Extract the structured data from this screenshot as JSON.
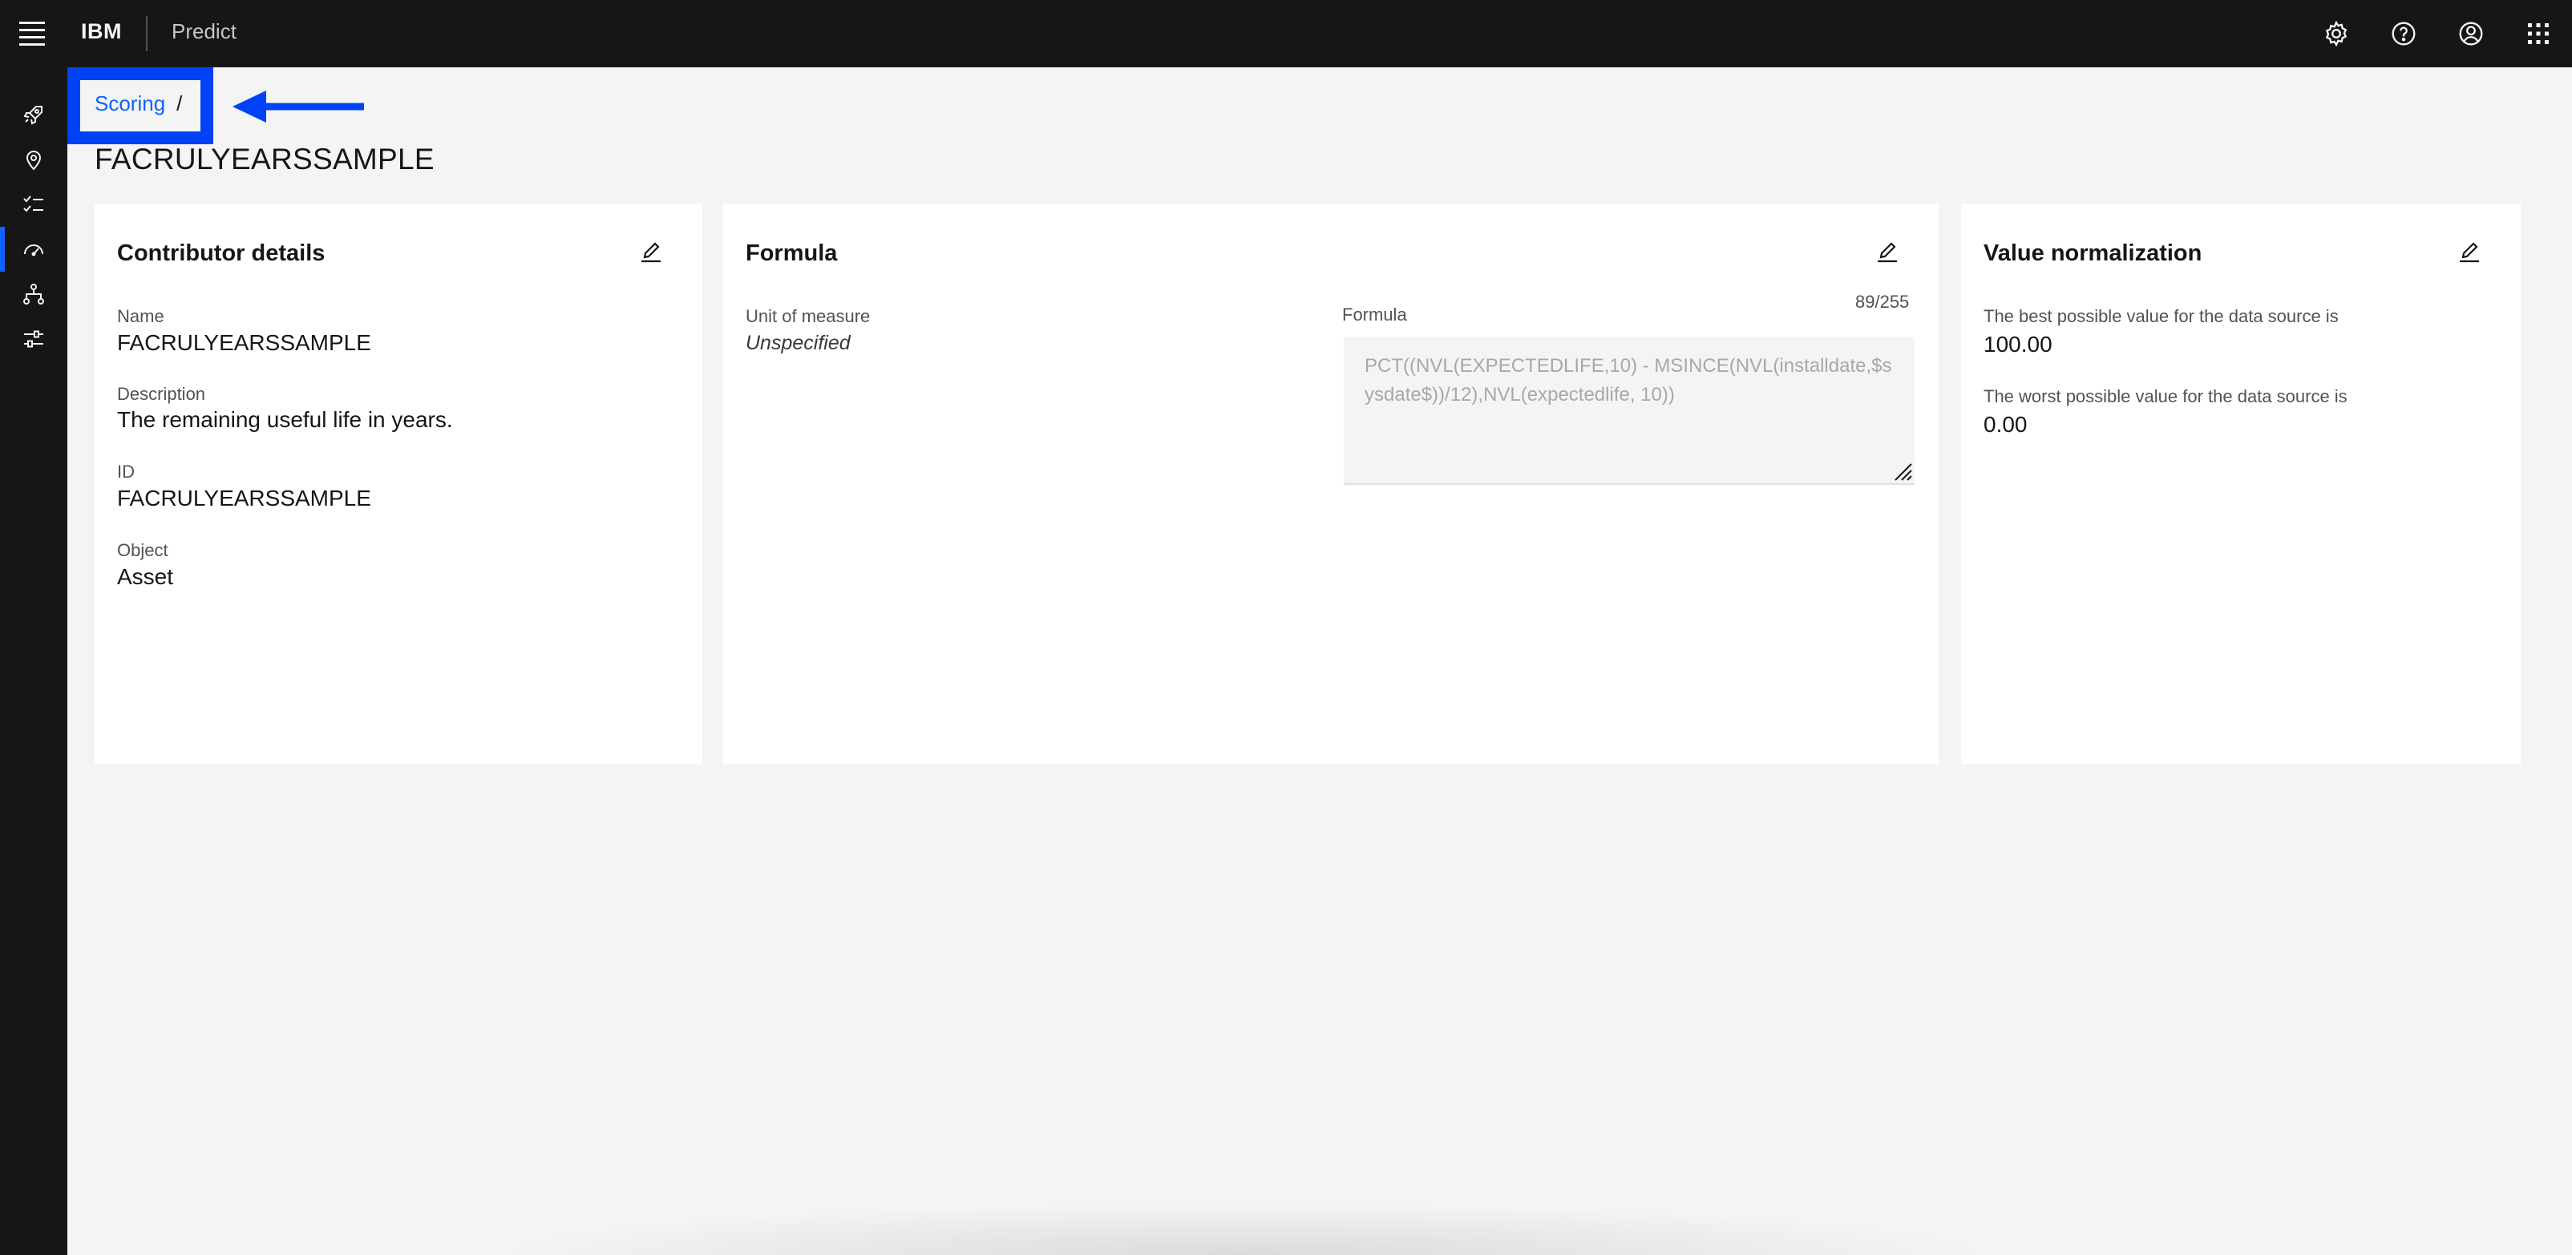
{
  "header": {
    "brand": "IBM",
    "product": "Predict",
    "icons": [
      "settings-icon",
      "help-icon",
      "user-avatar-icon",
      "app-switcher-icon"
    ]
  },
  "sidebar": {
    "items": [
      {
        "icon": "rocket-icon",
        "active": false
      },
      {
        "icon": "location-icon",
        "active": false
      },
      {
        "icon": "checklist-icon",
        "active": false
      },
      {
        "icon": "meter-icon",
        "active": true
      },
      {
        "icon": "hierarchy-icon",
        "active": false
      },
      {
        "icon": "sliders-icon",
        "active": false
      }
    ]
  },
  "breadcrumb": {
    "link": "Scoring",
    "separator": "/"
  },
  "page": {
    "title": "FACRULYEARSSAMPLE"
  },
  "contributor": {
    "title": "Contributor details",
    "name_label": "Name",
    "name_value": "FACRULYEARSSAMPLE",
    "description_label": "Description",
    "description_value": "The remaining useful life in years.",
    "id_label": "ID",
    "id_value": "FACRULYEARSSAMPLE",
    "object_label": "Object",
    "object_value": "Asset"
  },
  "formula": {
    "title": "Formula",
    "unit_label": "Unit of measure",
    "unit_value": "Unspecified",
    "formula_label": "Formula",
    "counter": "89/255",
    "formula_value": "PCT((NVL(EXPECTEDLIFE,10) - MSINCE(NVL(installdate,$sysdate$))/12),NVL(expectedlife, 10))"
  },
  "normalization": {
    "title": "Value normalization",
    "best_label": "The best possible value for the data source is",
    "best_value": "100.00",
    "worst_label": "The worst possible value for the data source is",
    "worst_value": "0.00"
  },
  "colors": {
    "accent": "#0f62fe",
    "highlight": "#0043f6",
    "header_bg": "#161616",
    "page_bg": "#f4f4f4"
  }
}
